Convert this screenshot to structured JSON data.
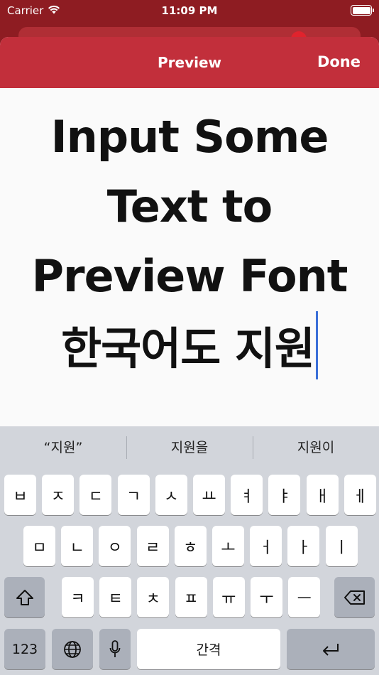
{
  "status_bar": {
    "carrier": "Carrier",
    "time": "11:09 PM"
  },
  "nav": {
    "title": "Preview",
    "done_label": "Done"
  },
  "preview": {
    "lines": [
      "Input Some",
      "Text to",
      "Preview Font",
      "한국어도 지원"
    ]
  },
  "keyboard": {
    "suggestions": [
      "“지원”",
      "지원을",
      "지원이"
    ],
    "row1": [
      "ㅂ",
      "ㅈ",
      "ㄷ",
      "ㄱ",
      "ㅅ",
      "ㅛ",
      "ㅕ",
      "ㅑ",
      "ㅐ",
      "ㅔ"
    ],
    "row2": [
      "ㅁ",
      "ㄴ",
      "ㅇ",
      "ㄹ",
      "ㅎ",
      "ㅗ",
      "ㅓ",
      "ㅏ",
      "ㅣ"
    ],
    "row3": [
      "ㅋ",
      "ㅌ",
      "ㅊ",
      "ㅍ",
      "ㅠ",
      "ㅜ",
      "ㅡ"
    ],
    "numbers_label": "123",
    "space_label": "간격"
  },
  "colors": {
    "nav_red": "#c22f3b",
    "background_red": "#8e1c22",
    "caret_blue": "#3a6fd8",
    "keyboard_bg": "#d2d5db"
  }
}
